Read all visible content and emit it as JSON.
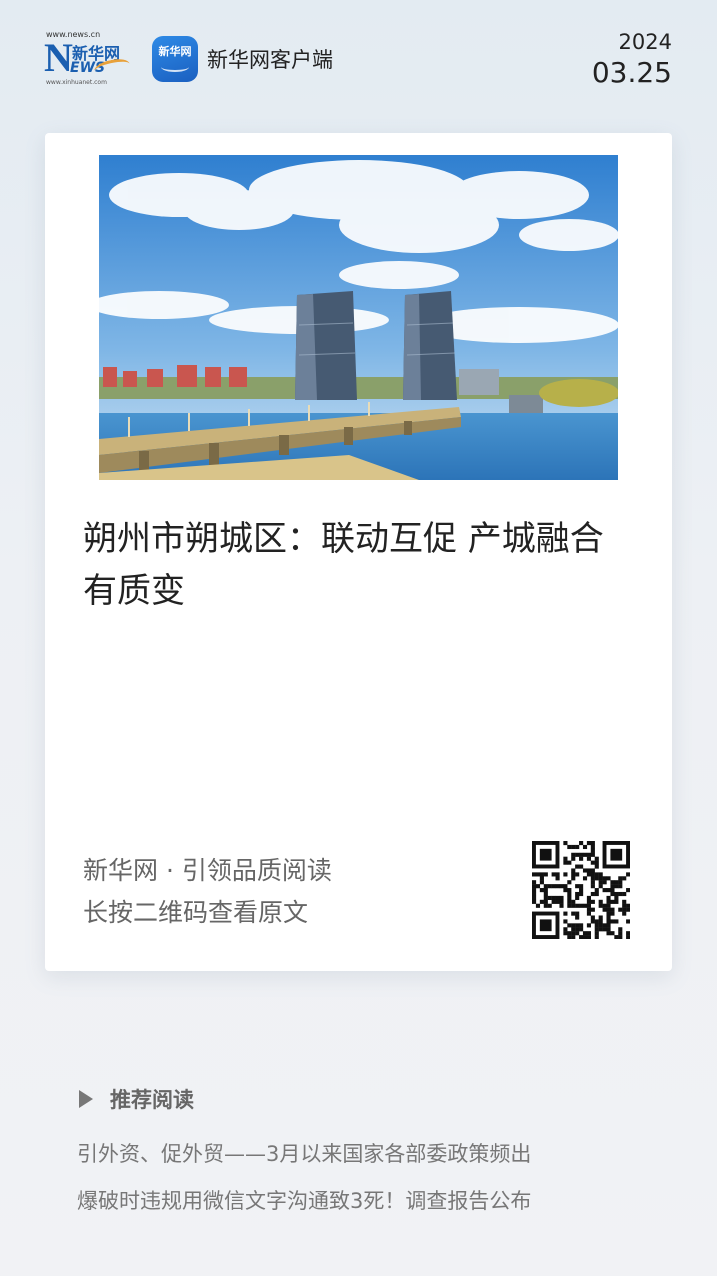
{
  "header": {
    "logo": {
      "url_top": "www.news.cn",
      "brand_cn": "新华网",
      "letter_n": "N",
      "letters_ews": "EWS",
      "url_bottom": "www.xinhuanet.com"
    },
    "app_icon_text": "新华网",
    "app_name": "新华网客户端",
    "date_year": "2024",
    "date_day": "03.25"
  },
  "card": {
    "headline": "朔州市朔城区：联动互促 产城融合有质变",
    "tagline": "新华网 · 引领品质阅读",
    "hint": "长按二维码查看原文"
  },
  "recommend": {
    "title": "推荐阅读",
    "items": [
      "引外资、促外贸——3月以来国家各部委政策频出",
      "爆破时违规用微信文字沟通致3死！调查报告公布"
    ]
  },
  "colors": {
    "brand_blue": "#1b5fb0",
    "app_icon_blue": "#2e8ae6",
    "sky": "#3f8fd6",
    "water": "#3a86c8"
  },
  "icons": [
    "xinhuanet-news-logo",
    "xinhua-app-icon",
    "qr-code",
    "play-arrow-icon"
  ]
}
